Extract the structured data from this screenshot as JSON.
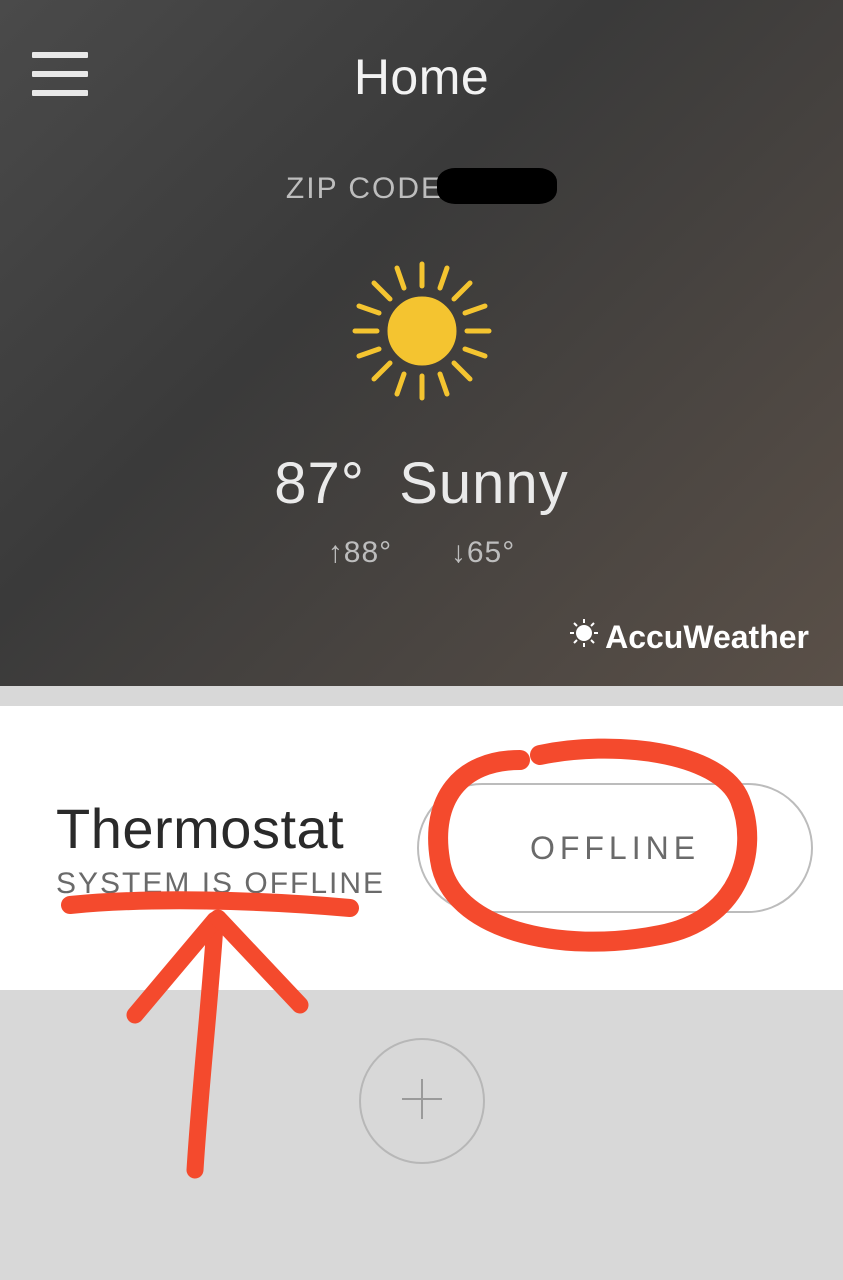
{
  "header": {
    "title": "Home"
  },
  "weather": {
    "zip_label": "ZIP CODE",
    "temp": "87°",
    "condition": "Sunny",
    "high_prefix": "↑",
    "high": "88°",
    "low_prefix": "↓",
    "low": "65°",
    "provider": "AccuWeather"
  },
  "thermostat": {
    "title": "Thermostat",
    "status": "SYSTEM IS OFFLINE",
    "pill": "OFFLINE"
  }
}
